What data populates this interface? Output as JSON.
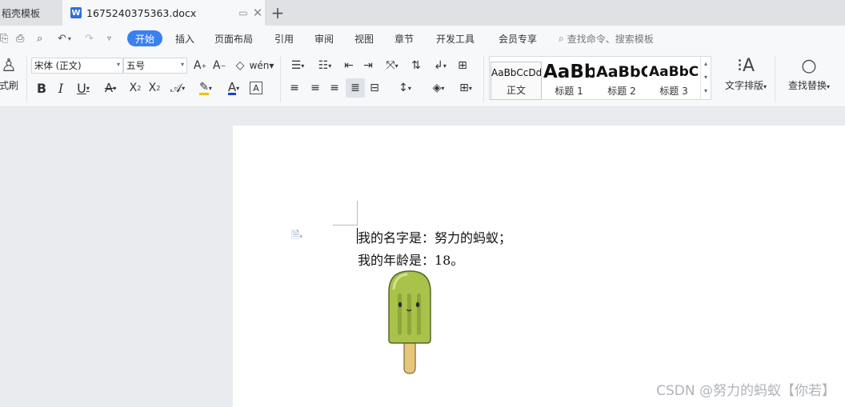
{
  "tabs": {
    "prev_label": "稻壳模板",
    "active_label": "1675240375363.docx",
    "doc_icon_letter": "W"
  },
  "menu": {
    "items": [
      "开始",
      "插入",
      "页面布局",
      "引用",
      "审阅",
      "视图",
      "章节",
      "开发工具",
      "会员专享"
    ],
    "search_placeholder": "查找命令、搜索模板"
  },
  "ribbon": {
    "format_painter": "式刷",
    "font_name": "宋体 (正文)",
    "font_size": "五号",
    "styles": [
      {
        "preview": "AaBbCcDd",
        "name": "正文"
      },
      {
        "preview": "AaBb",
        "name": "标题 1"
      },
      {
        "preview": "AaBbC",
        "name": "标题 2"
      },
      {
        "preview": "AaBbC",
        "name": "标题 3"
      }
    ],
    "text_layout": "文字排版",
    "find_replace": "查找替换"
  },
  "document": {
    "line1": "我的名字是：努力的蚂蚁；",
    "line2": "我的年龄是：18。"
  },
  "watermark": "CSDN @努力的蚂蚁【你若】",
  "colors": {
    "accent": "#3a80f0",
    "font_color_underline": "#1a3fd6",
    "highlight_underline": "#f0c000",
    "popsicle_green": "#a8c24a",
    "popsicle_stick": "#e6c77a"
  }
}
